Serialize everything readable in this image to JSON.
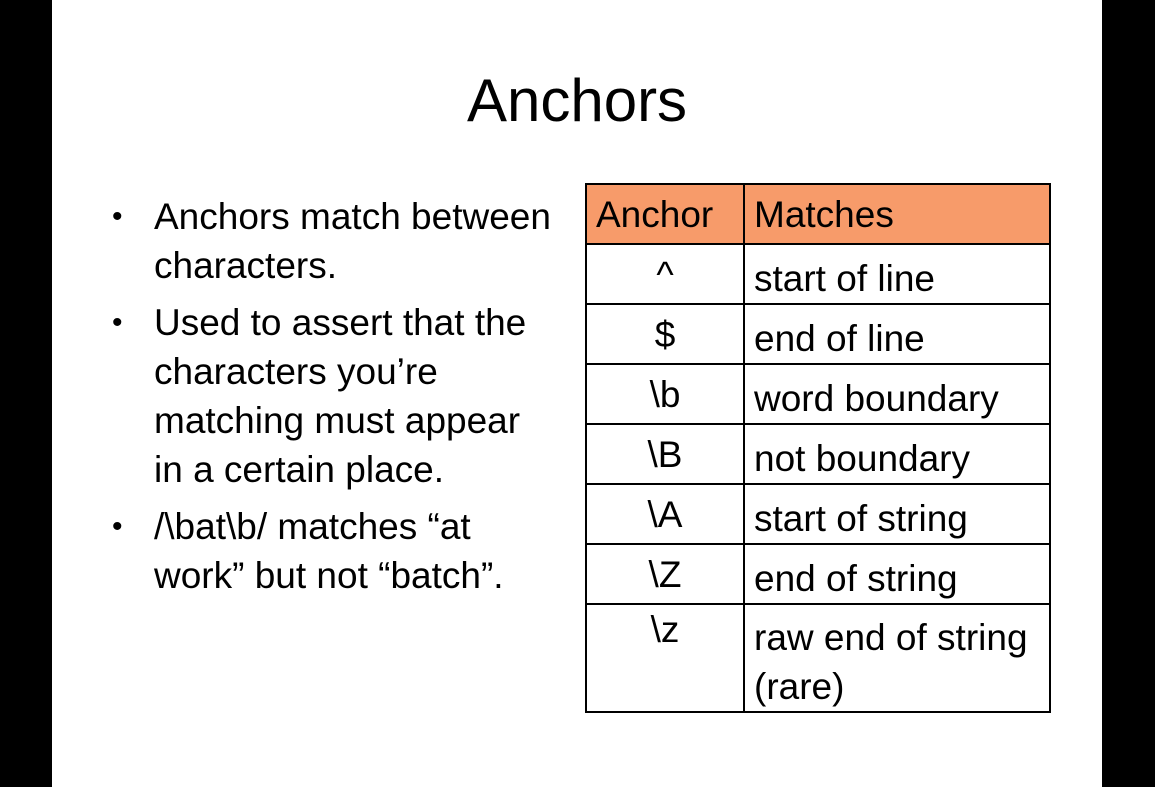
{
  "slide": {
    "title": "Anchors",
    "bullets": [
      "Anchors match between characters.",
      "Used to assert that the characters you’re matching must appear in a certain place.",
      "/\\bat\\b/ matches “at work” but not “batch”."
    ],
    "bullet_marker": "•"
  },
  "table": {
    "header_color": "#f79b6a",
    "headers": [
      "Anchor",
      "Matches"
    ],
    "rows": [
      {
        "anchor": "^",
        "matches": "start of line"
      },
      {
        "anchor": "$",
        "matches": "end of line"
      },
      {
        "anchor": "\\b",
        "matches": "word boundary"
      },
      {
        "anchor": "\\B",
        "matches": "not boundary"
      },
      {
        "anchor": "\\A",
        "matches": "start of string"
      },
      {
        "anchor": "\\Z",
        "matches": "end of string"
      },
      {
        "anchor": "\\z",
        "matches": "raw end of string (rare)"
      }
    ]
  }
}
